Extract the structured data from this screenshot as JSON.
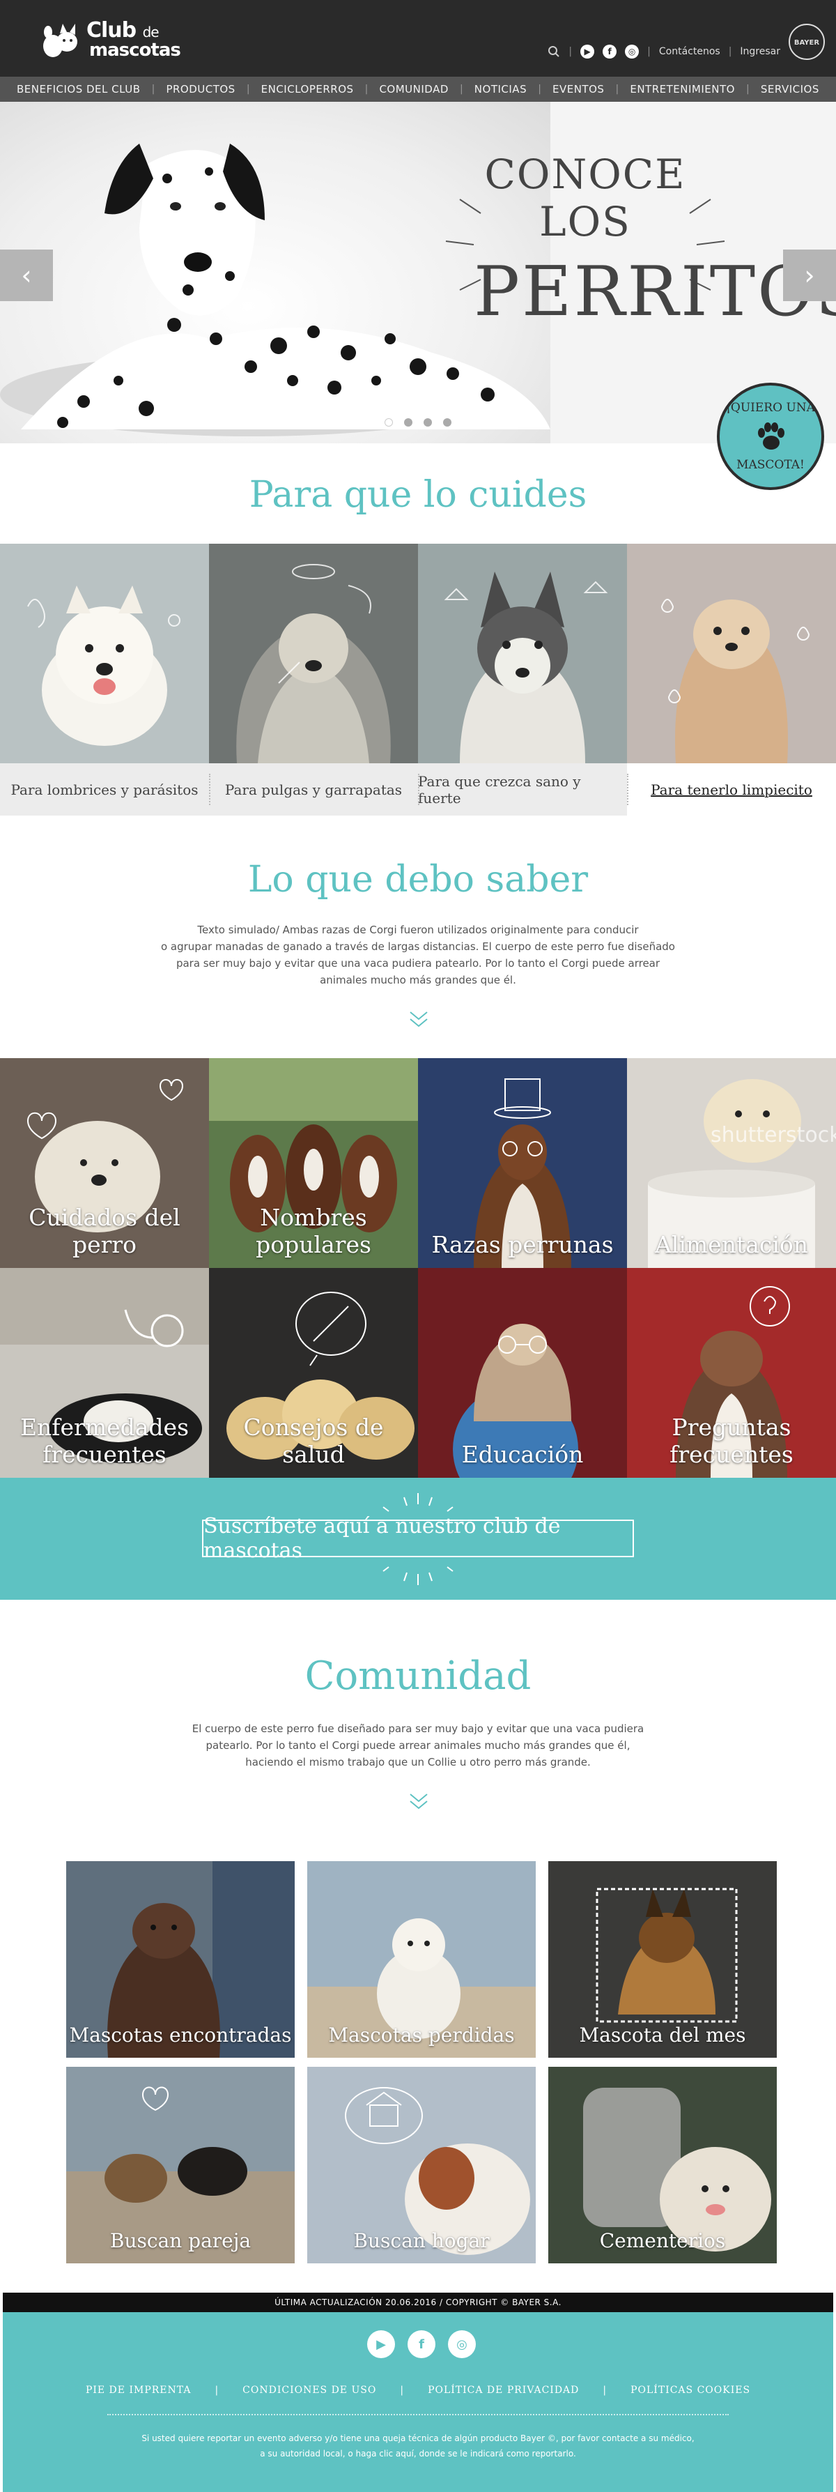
{
  "header": {
    "logo_line1": "Club",
    "logo_line1_small": "de",
    "logo_line2": "mascotas",
    "contact_label": "Contáctenos",
    "login_label": "Ingresar",
    "sep": "|",
    "bayer_h": "BAYER",
    "bayer_v": [
      "B",
      "A",
      "",
      "E",
      "R"
    ],
    "social": {
      "youtube": "▶",
      "facebook": "f",
      "instagram": "◎"
    }
  },
  "nav": {
    "items": [
      "BENEFICIOS DEL CLUB",
      "PRODUCTOS",
      "ENCICLOPERROS",
      "COMUNIDAD",
      "NOTICIAS",
      "EVENTOS",
      "ENTRETENIMIENTO",
      "SERVICIOS"
    ],
    "sep": "|"
  },
  "hero": {
    "title_line1": "CONOCE LOS",
    "title_line2": "PERRITOS",
    "prev": "‹",
    "next": "›",
    "slides": 4,
    "active_slide": 1,
    "badge_top": "¡QUIERO UNA",
    "badge_bottom": "MASCOTA!"
  },
  "care": {
    "title": "Para que lo cuides",
    "items": [
      {
        "label": "Para lombrices y parásitos",
        "active": false
      },
      {
        "label": "Para pulgas y garrapatas",
        "active": false
      },
      {
        "label": "Para que crezca sano y fuerte",
        "active": false
      },
      {
        "label": "Para tenerlo limpiecito",
        "active": true
      }
    ]
  },
  "know": {
    "title": "Lo que debo saber",
    "text_lines": [
      "Texto simulado/ Ambas razas de Corgi fueron utilizados originalmente para conducir",
      "o agrupar manadas de ganado a través de largas distancias. El cuerpo de este perro fue diseñado",
      "para ser muy bajo y evitar que una vaca pudiera patearlo. Por lo tanto el Corgi puede arrear",
      "animales mucho más grandes que él."
    ]
  },
  "tiles": [
    "Cuidados del perro",
    "Nombres populares",
    "Razas perrunas",
    "Alimentación",
    "Enfermedades frecuentes",
    "Consejos de salud",
    "Educación",
    "Preguntas frecuentes"
  ],
  "watermark": "shutterstock",
  "subscribe": {
    "label": "Suscríbete aquí a nuestro club de mascotas"
  },
  "community": {
    "title": "Comunidad",
    "text_lines": [
      "El cuerpo de este perro fue diseñado para ser muy bajo y evitar que una vaca pudiera",
      "patearlo. Por lo tanto el Corgi puede arrear animales mucho más grandes que él,",
      "haciendo el mismo trabajo que un Collie u otro perro más grande."
    ],
    "tiles": [
      "Mascotas encontradas",
      "Mascotas perdidas",
      "Mascota del mes",
      "Buscan pareja",
      "Buscan hogar",
      "Cementerios"
    ]
  },
  "footer": {
    "bar": "ÚLTIMA ACTUALIZACIÓN 20.06.2016  /  COPYRIGHT © BAYER S.A.",
    "links": [
      "PIE DE IMPRENTA",
      "CONDICIONES DE USO",
      "POLÍTICA DE PRIVACIDAD",
      "POLÍTICAS COOKIES"
    ],
    "sep": "|",
    "note_lines": [
      "Si usted quiere reportar un evento adverso y/o tiene una queja técnica de algún producto Bayer ©, por favor contacte a su médico,",
      "a su autoridad local, o haga clic aquí, donde se le indicará como reportarlo."
    ]
  },
  "colors": {
    "teal": "#5ec2c2",
    "header": "#2a2a2a",
    "nav": "#545454"
  }
}
